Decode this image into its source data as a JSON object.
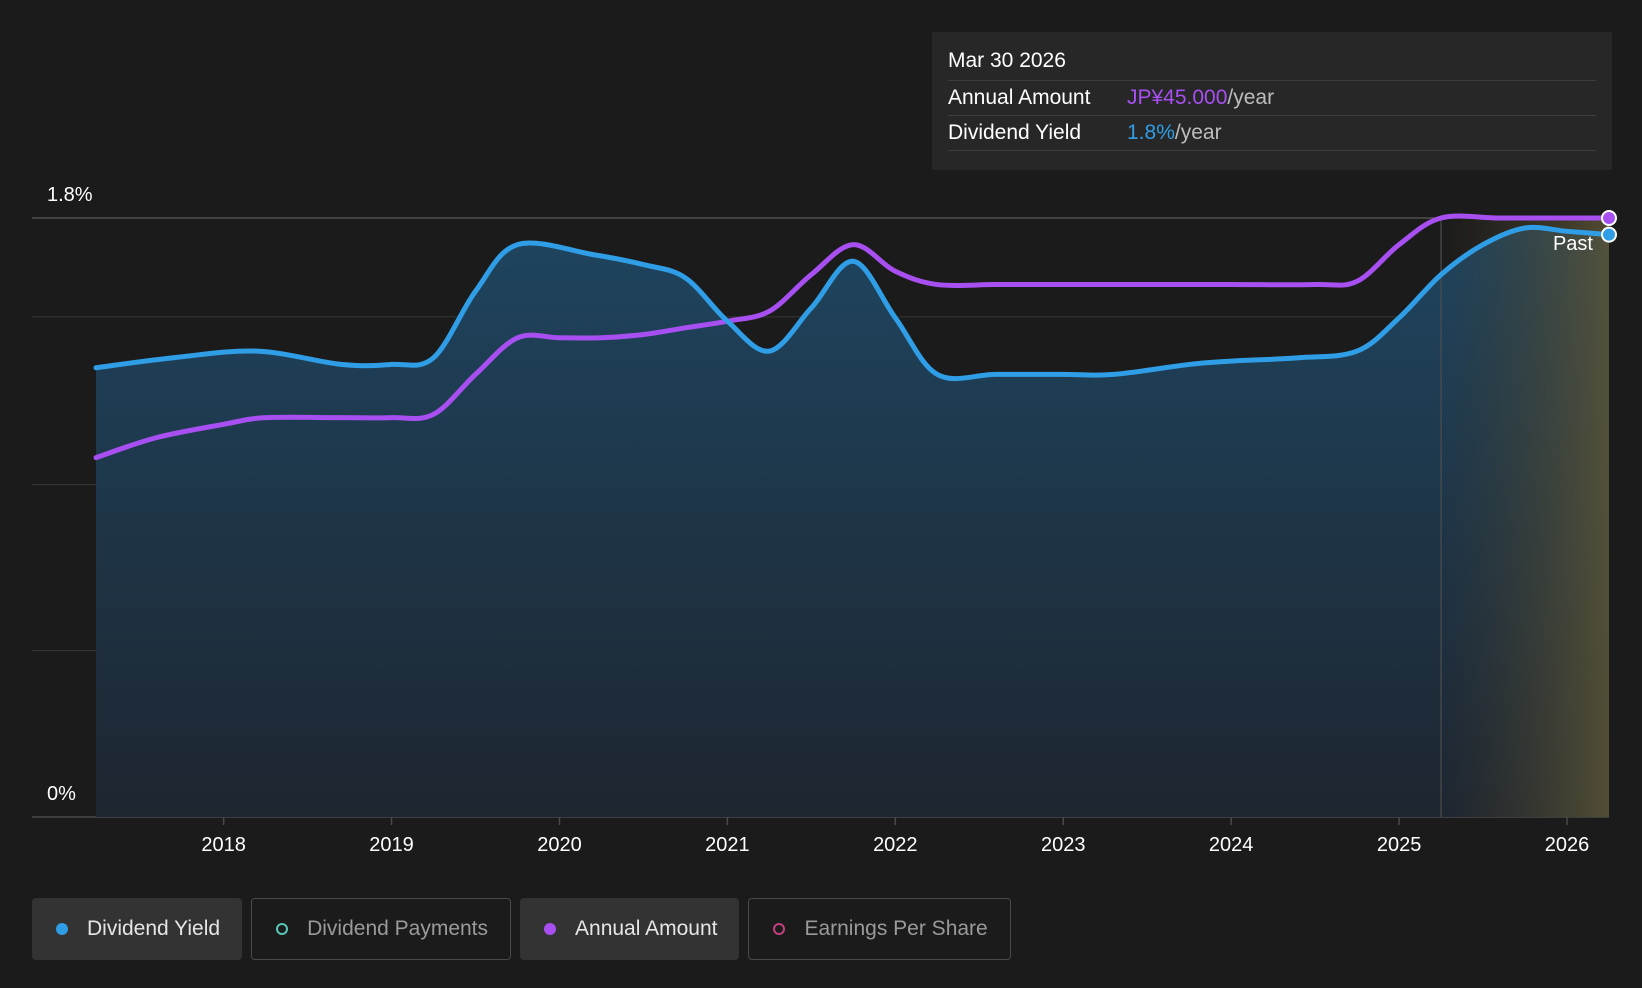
{
  "tooltip": {
    "date": "Mar 30 2026",
    "rows": [
      {
        "label": "Annual Amount",
        "value": "JP¥45.000",
        "unit": "/year",
        "color": "#a74ff0"
      },
      {
        "label": "Dividend Yield",
        "value": "1.8%",
        "unit": "/year",
        "color": "#2f9ee6"
      }
    ]
  },
  "legend": [
    {
      "label": "Dividend Yield",
      "active": true,
      "color": "#2f9ee6"
    },
    {
      "label": "Dividend Payments",
      "active": false,
      "color": "#57c7b7"
    },
    {
      "label": "Annual Amount",
      "active": true,
      "color": "#a74ff0"
    },
    {
      "label": "Earnings Per Share",
      "active": false,
      "color": "#c2407f"
    }
  ],
  "chart_data": {
    "type": "line",
    "ylim": [
      0,
      1.8
    ],
    "y_ticks": [
      {
        "label": "1.8%",
        "value": 1.8
      },
      {
        "label": "0%",
        "value": 0
      }
    ],
    "x_ticks": [
      "2018",
      "2019",
      "2020",
      "2021",
      "2022",
      "2023",
      "2024",
      "2025",
      "2026"
    ],
    "x_range": [
      2017.24,
      2026.25
    ],
    "forecast_start": 2025.25,
    "forecast_label": "Past",
    "series": [
      {
        "name": "Dividend Yield",
        "color": "#2f9ee6",
        "area": true,
        "points": [
          [
            2017.24,
            1.35
          ],
          [
            2017.7,
            1.38
          ],
          [
            2018.2,
            1.4
          ],
          [
            2018.7,
            1.36
          ],
          [
            2019.0,
            1.36
          ],
          [
            2019.25,
            1.38
          ],
          [
            2019.5,
            1.58
          ],
          [
            2019.75,
            1.72
          ],
          [
            2020.2,
            1.69
          ],
          [
            2020.5,
            1.66
          ],
          [
            2020.75,
            1.62
          ],
          [
            2021.0,
            1.49
          ],
          [
            2021.25,
            1.4
          ],
          [
            2021.5,
            1.53
          ],
          [
            2021.75,
            1.67
          ],
          [
            2022.0,
            1.5
          ],
          [
            2022.25,
            1.33
          ],
          [
            2022.6,
            1.33
          ],
          [
            2023.0,
            1.33
          ],
          [
            2023.3,
            1.33
          ],
          [
            2023.75,
            1.36
          ],
          [
            2024.0,
            1.37
          ],
          [
            2024.4,
            1.38
          ],
          [
            2024.75,
            1.4
          ],
          [
            2025.0,
            1.5
          ],
          [
            2025.25,
            1.63
          ],
          [
            2025.5,
            1.72
          ],
          [
            2025.75,
            1.77
          ],
          [
            2026.0,
            1.76
          ],
          [
            2026.25,
            1.75
          ]
        ]
      },
      {
        "name": "Annual Amount",
        "color": "#a74ff0",
        "area": false,
        "points": [
          [
            2017.24,
            1.08
          ],
          [
            2017.6,
            1.14
          ],
          [
            2018.0,
            1.18
          ],
          [
            2018.25,
            1.2
          ],
          [
            2018.7,
            1.2
          ],
          [
            2019.0,
            1.2
          ],
          [
            2019.25,
            1.21
          ],
          [
            2019.5,
            1.33
          ],
          [
            2019.75,
            1.44
          ],
          [
            2020.0,
            1.44
          ],
          [
            2020.25,
            1.44
          ],
          [
            2020.5,
            1.45
          ],
          [
            2020.75,
            1.47
          ],
          [
            2021.0,
            1.49
          ],
          [
            2021.25,
            1.52
          ],
          [
            2021.5,
            1.63
          ],
          [
            2021.75,
            1.72
          ],
          [
            2022.0,
            1.64
          ],
          [
            2022.25,
            1.6
          ],
          [
            2022.6,
            1.6
          ],
          [
            2023.0,
            1.6
          ],
          [
            2023.5,
            1.6
          ],
          [
            2024.0,
            1.6
          ],
          [
            2024.5,
            1.6
          ],
          [
            2024.75,
            1.61
          ],
          [
            2025.0,
            1.72
          ],
          [
            2025.25,
            1.8
          ],
          [
            2025.6,
            1.8
          ],
          [
            2026.0,
            1.8
          ],
          [
            2026.25,
            1.8
          ]
        ]
      }
    ]
  }
}
